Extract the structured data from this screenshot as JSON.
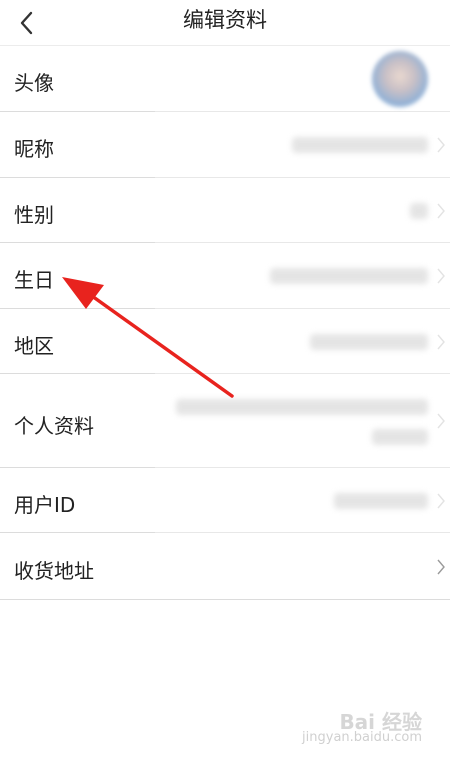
{
  "header": {
    "back_icon": "chevron-left-icon",
    "title": "编辑资料"
  },
  "rows": [
    {
      "key": "avatar",
      "label": "头像"
    },
    {
      "key": "nickname",
      "label": "昵称"
    },
    {
      "key": "gender",
      "label": "性别"
    },
    {
      "key": "birthday",
      "label": "生日"
    },
    {
      "key": "region",
      "label": "地区"
    },
    {
      "key": "profile",
      "label": "个人资料"
    },
    {
      "key": "user_id",
      "label": "用户ID"
    },
    {
      "key": "address",
      "label": "收货地址"
    }
  ],
  "annotation": {
    "arrow_color": "#e8231e",
    "arrow_target": "生日"
  },
  "watermark": {
    "brand": "Bai 经验",
    "url": "jingyan.baidu.com"
  }
}
